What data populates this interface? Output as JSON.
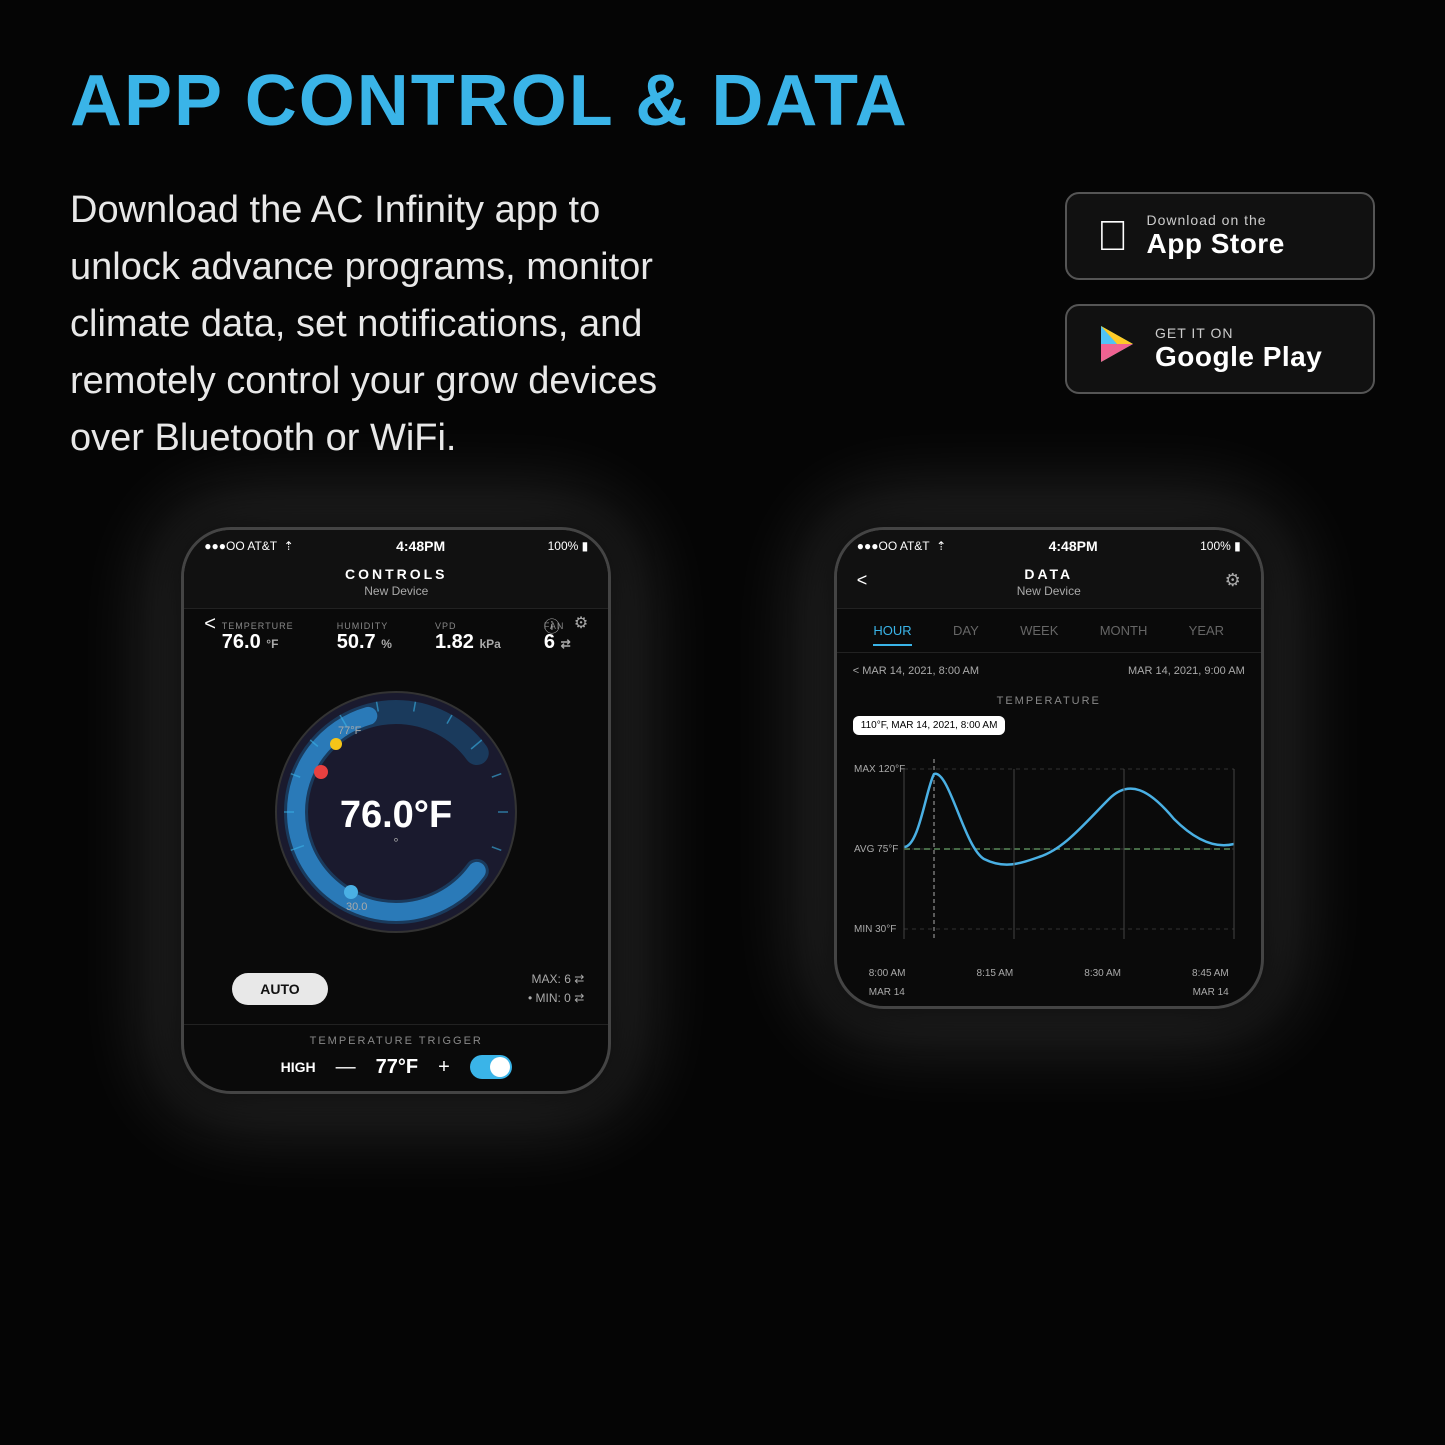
{
  "page": {
    "background": "#050505"
  },
  "title": "APP CONTROL & DATA",
  "description": "Download the AC Infinity app to unlock advance programs, monitor climate data, set notifications, and remotely control your grow devices over Bluetooth or WiFi.",
  "app_store": {
    "sub_label": "Download on the",
    "main_label": "App Store"
  },
  "google_play": {
    "sub_label": "GET IT ON",
    "main_label": "Google Play"
  },
  "phone_controls": {
    "status_left": "●●●OO AT&T  ✈",
    "status_center": "4:48PM",
    "status_right": "100% 🔋",
    "screen_title": "CONTROLS",
    "screen_sub": "New Device",
    "stats": [
      {
        "label": "TEMPERTURE",
        "value": "76.0",
        "unit": "°F"
      },
      {
        "label": "HUMIDITY",
        "value": "50.7",
        "unit": "%"
      },
      {
        "label": "VPD",
        "value": "1.82",
        "unit": " kPa"
      },
      {
        "label": "FAN",
        "value": "6",
        "unit": " ⇄"
      }
    ],
    "gauge_temp": "76.0°F",
    "auto_label": "AUTO",
    "max_label": "MAX: 6 ⇄",
    "min_label": "• MIN: 0 ⇄",
    "trigger_section": "TEMPERATURE TRIGGER",
    "trigger_label": "HIGH",
    "trigger_value": "77°F",
    "trigger_minus": "—",
    "trigger_plus": "+"
  },
  "phone_data": {
    "status_left": "●●●OO AT&T  ✈",
    "status_center": "4:48PM",
    "status_right": "100% 🔋",
    "screen_title": "DATA",
    "screen_sub": "New Device",
    "tabs": [
      "HOUR",
      "DAY",
      "WEEK",
      "MONTH",
      "YEAR"
    ],
    "active_tab": "HOUR",
    "date_left": "< MAR 14, 2021, 8:00 AM",
    "date_right": "MAR 14, 2021, 9:00 AM",
    "chart_title": "TEMPERATURE",
    "tooltip": "110°F, MAR 14, 2021, 8:00 AM",
    "y_labels": [
      "MAX 120°F",
      "AVG 75°F",
      "MIN 30°F"
    ],
    "x_labels": [
      "8:00 AM",
      "8:15 AM",
      "8:30 AM",
      "8:45 AM"
    ],
    "x_bottom": [
      "MAR 14",
      "",
      "",
      "MAR 14"
    ]
  }
}
